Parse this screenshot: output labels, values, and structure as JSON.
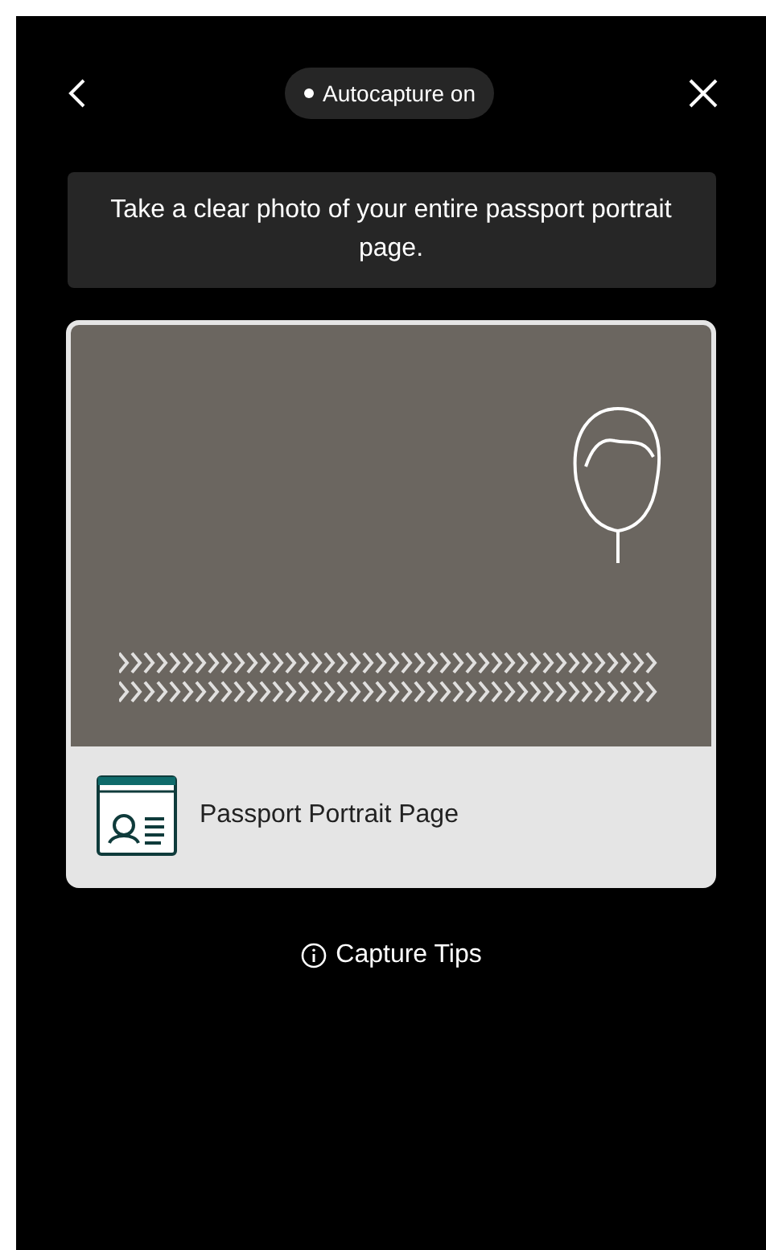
{
  "header": {
    "status": "Autocapture on"
  },
  "instruction": "Take a clear photo of your entire passport portrait page.",
  "document": {
    "label": "Passport Portrait Page"
  },
  "tips": {
    "label": "Capture Tips"
  }
}
